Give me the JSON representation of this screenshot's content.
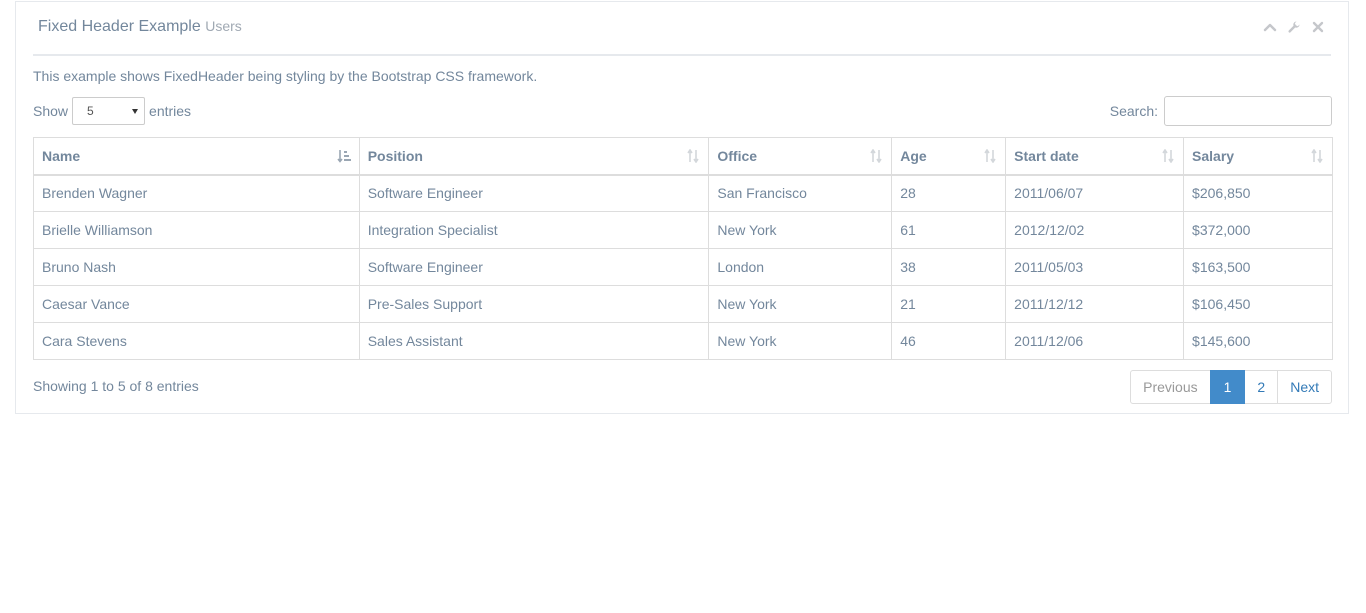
{
  "panel": {
    "title": "Fixed Header Example",
    "subtitle": "Users",
    "tools": [
      "chevron-up-icon",
      "wrench-icon",
      "close-icon"
    ]
  },
  "description": "This example shows FixedHeader being styling by the Bootstrap CSS framework.",
  "length": {
    "show_label": "Show",
    "value": "5",
    "entries_label": "entries"
  },
  "search": {
    "label": "Search:",
    "value": "",
    "placeholder": ""
  },
  "table": {
    "columns": [
      "Name",
      "Position",
      "Office",
      "Age",
      "Start date",
      "Salary"
    ],
    "sorted_column": "Name",
    "rows": [
      [
        "Brenden Wagner",
        "Software Engineer",
        "San Francisco",
        "28",
        "2011/06/07",
        "$206,850"
      ],
      [
        "Brielle Williamson",
        "Integration Specialist",
        "New York",
        "61",
        "2012/12/02",
        "$372,000"
      ],
      [
        "Bruno Nash",
        "Software Engineer",
        "London",
        "38",
        "2011/05/03",
        "$163,500"
      ],
      [
        "Caesar Vance",
        "Pre-Sales Support",
        "New York",
        "21",
        "2011/12/12",
        "$106,450"
      ],
      [
        "Cara Stevens",
        "Sales Assistant",
        "New York",
        "46",
        "2011/12/06",
        "$145,600"
      ]
    ]
  },
  "info": "Showing 1 to 5 of 8 entries",
  "pagination": {
    "previous": "Previous",
    "pages": [
      "1",
      "2"
    ],
    "active": "1",
    "next": "Next"
  },
  "colors": {
    "text": "#73879C",
    "active_page": "#428BCA",
    "link": "#337AB7"
  }
}
